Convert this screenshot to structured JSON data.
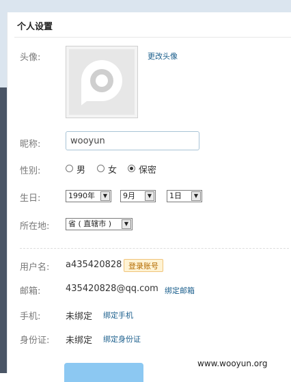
{
  "panel": {
    "title": "个人设置"
  },
  "avatar": {
    "label": "头像:",
    "change_link": "更改头像"
  },
  "nickname": {
    "label": "昵称:",
    "value": "wooyun"
  },
  "gender": {
    "label": "性别:",
    "options": [
      "男",
      "女",
      "保密"
    ],
    "selected": "保密"
  },
  "birthday": {
    "label": "生日:",
    "year": "1990年",
    "month": "9月",
    "day": "1日"
  },
  "location": {
    "label": "所在地:",
    "province": "省 ( 直辖市 )"
  },
  "account": {
    "username_label": "用户名:",
    "username": "a435420828",
    "username_badge": "登录账号",
    "email_label": "邮箱:",
    "email": "435420828@qq.com",
    "email_link": "绑定邮箱",
    "phone_label": "手机:",
    "phone_value": "未绑定",
    "phone_link": "绑定手机",
    "id_label": "身份证:",
    "id_value": "未绑定",
    "id_link": "绑定身份证"
  },
  "watermark": "www.wooyun.org",
  "colors": {
    "link": "#1a5e8c",
    "badge_bg": "#fff3d4",
    "input_border": "#a8c3d6",
    "save_button": "#8cc8f2"
  },
  "icons": {
    "avatar_placeholder": "p-logo-icon",
    "select_arrow": "chevron-down-icon"
  }
}
